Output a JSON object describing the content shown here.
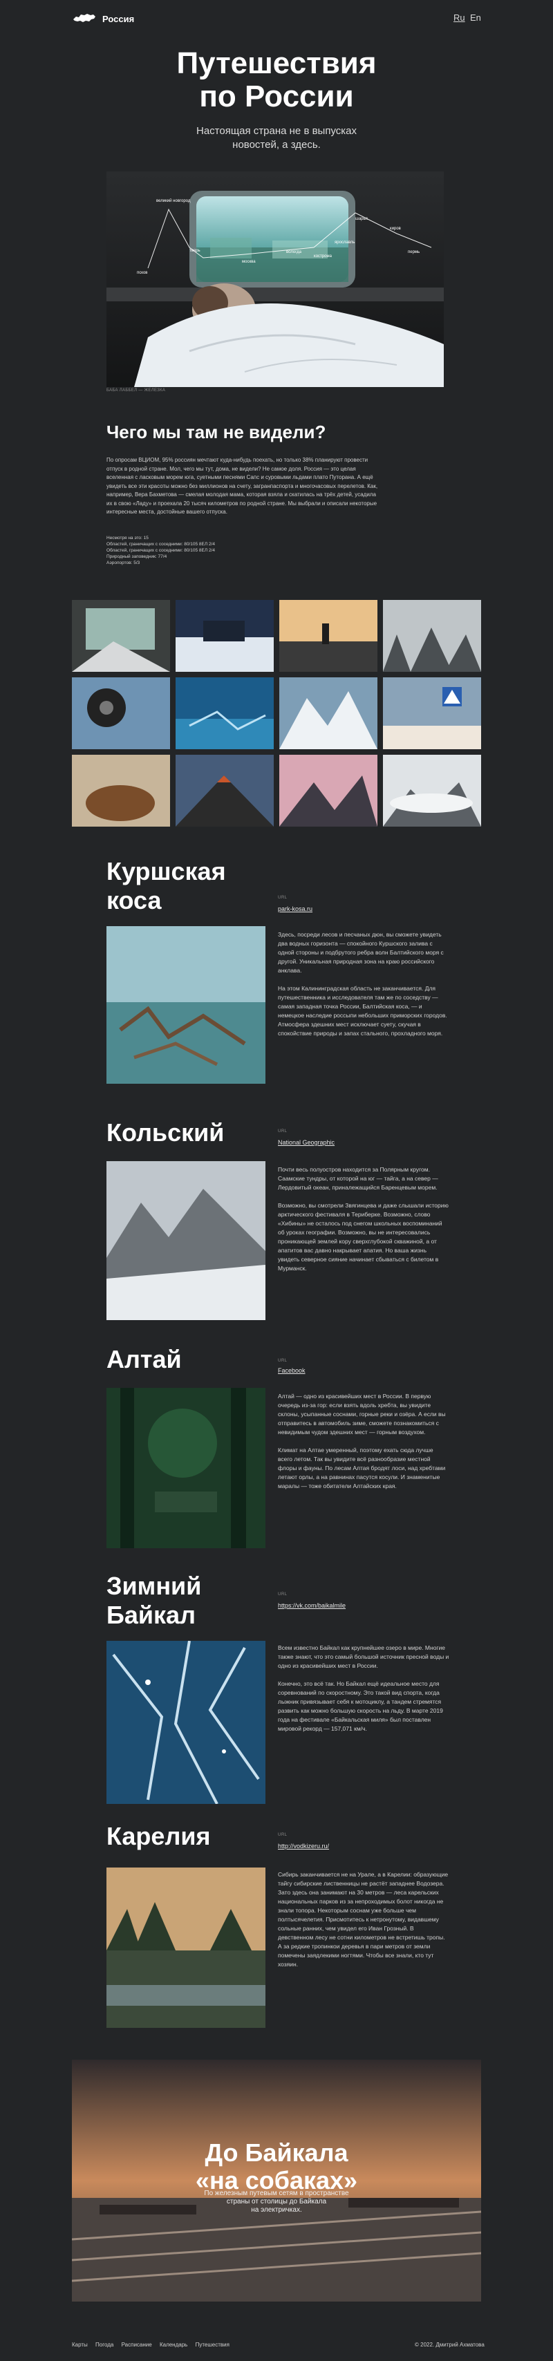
{
  "header": {
    "brand": "Россия",
    "lang_ru": "Ru",
    "lang_en": "En"
  },
  "hero": {
    "title_line1": "Путешествия",
    "title_line2": "по России",
    "subtitle_line1": "Настоящая страна не в выпусках",
    "subtitle_line2": "новостей, а здесь.",
    "chart_labels": {
      "l1": "великий новгород",
      "l2": "псков",
      "l3": "тверь",
      "l4": "москва",
      "l5": "вологда",
      "l6": "кострома",
      "l7": "ярославль",
      "l8": "шарья",
      "l9": "киров",
      "l10": "пермь"
    },
    "caption": "БАБА ЛАББЕЛ — ЖЕЛЕЗКА"
  },
  "intro": {
    "title": "Чего мы там не видели?",
    "text": "По опросам ВЦИОМ, 95% россиян мечтают куда-нибудь поехать, но только 38% планируют провести отпуск в родной стране. Мол, чего мы тут, дома, не видели? Не самое доля. Россия — это целая вселенная с ласковым морем юга, суетными песнями Сапс и суровыми льдами плато Путорана. А ещё увидеть все эти красоты можно без миллионов на счету, загранпаспорта и многочасовых перелетов. Как, например, Вера Бахметова — смелая молодая мама, которая взяла и скатилась на трёх детей, усадила их в свою «Ладу» и проехала 20 тысяч километров по родной стране. Мы выбрали и описали некоторые интересные места, достойные вашего отпуска.",
    "stats": [
      "Несмотря на это: 15",
      "Областей, граничащих с соседними: 80/105 8ЕЛ 2/4",
      "Областей, граничащих с соседними: 80/105 8ЕЛ 2/4",
      "Природный заповедник: 77/4",
      "Аэропортов: 5/3"
    ]
  },
  "destinations": [
    {
      "title_line1": "Куршская",
      "title_line2": "коса",
      "label": "URL",
      "link": "park-kosa.ru",
      "p1": "Здесь, посреди лесов и песчаных дюн, вы сможете увидеть два водных горизонта — спокойного Куршского залива с одной стороны и подбрутого ребра волн Балтийского моря с другой. Уникальная природная зона на краю российского анклава.",
      "p2": "На этом Калининградская область не заканчивается. Для путешественника и исследователя там же по соседству — самая западная точка России, Балтийская коса, — и немецкое наследие россыпи небольших приморских городов. Атмосфера здешних мест исключает суету, скучая в спокойствие природы и запах стального, прохладного моря."
    },
    {
      "title_line1": "Кольский",
      "title_line2": "",
      "label": "URL",
      "link": "National Geographic",
      "p1": "Почти весь полуостров находится за Полярным кругом. Саамские тундры, от которой на юг — тайга, а на север — Лердовитый океан, приналежащийся Баренцевым морем.",
      "p2": "Возможно, вы смотрели Звягинцева и даже слышали историю арктического фестиваля в Териберке. Возможно, слово «Хибины» не осталось под снегом школьных воспоминаний об уроках географии. Возможно, вы не интересовались проникающей землей кору сверхглубокой скважиной, а от апатитов вас давно накрывает апатия. Но ваша жизнь увидеть северное сияние начинает сбываться с билетом в Мурманск."
    },
    {
      "title_line1": "Алтай",
      "title_line2": "",
      "label": "URL",
      "link": "Facebook",
      "p1": "Алтай — одно из красивейших мест в России. В первую очередь из-за гор: если взять вдоль хребта, вы увидите склоны, усыпанные соснами, горные реки и озёра. А если вы отправитесь в автомобиль зиме, сможете познакомиться с невидимым чудом здешних мест — горным воздухом.",
      "p2": "Климат на Алтае умеренный, поэтому ехать сюда лучше всего летом. Так вы увидите всё разнообразие местной флоры и фауны. По лесам Алтая бродят лоси, над хребтами летают орлы, а на равнинах пасутся косули. И знаменитые маралы — тоже обитатели Алтайских края."
    },
    {
      "title_line1": "Зимний",
      "title_line2": "Байкал",
      "label": "URL",
      "link": "https://vk.com/baikalmile",
      "p1": "Всем известно Байкал как крупнейшее озеро в мире. Многие также знают, что это самый большой источник пресной воды и одно из красивейших мест в России.",
      "p2": "Конечно, это всё так. Но Байкал ещё идеальное место для соревнований по скоростному. Это такой вид спорта, когда лыжник привязывает себя к мотоциклу, а тандем стремятся развить как можно большую скорость на льду. В марте 2019 года на фестивале «Байкальская миля» был поставлен мировой рекорд — 157,071 км/ч."
    },
    {
      "title_line1": "Карелия",
      "title_line2": "",
      "label": "URL",
      "link": "http://vodkizeru.ru/",
      "p1": "Сибирь заканчивается не на Урале, а в Карелии: образующие тайгу сибирские лиственницы не растёт западнее Водозера. Зато здесь она занимают на 30 метров — леса карельских национальных парков из за непроходимых болот никогда не знали топора. Некоторым соснам уже больше чем полтысячелетия. Присмотитесь к нетронутому, видавшему сольные ранних, чем увидел его Иван Грозный. В девственном лесу не сотни километров не встретишь тропы. А за редкие тропинкои деревья в пари метров от земли помечены заядлекими ногтями. Чтобы все знали, кто тут хозяин."
    }
  ],
  "banner": {
    "title_line1": "До Байкала",
    "title_line2": "«на собаках»",
    "sub_line1": "По железным путевым сетям в пространстве",
    "sub_line2": "страны от столицы до Байкала",
    "sub_line3": "на электричках."
  },
  "footer": {
    "nav": [
      "Карты",
      "Погода",
      "Расписание",
      "Календарь",
      "Путешествия"
    ],
    "copyright": "© 2022. Дмитрий Ахматова"
  }
}
